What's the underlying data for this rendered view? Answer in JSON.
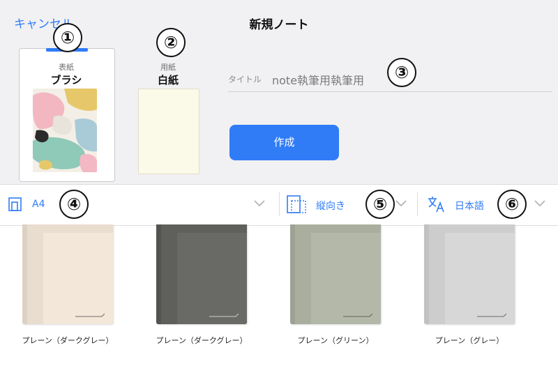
{
  "header": {
    "cancel": "キャンセル",
    "title": "新規ノート"
  },
  "cover": {
    "section_label": "表紙",
    "name": "ブラシ"
  },
  "paper": {
    "section_label": "用紙",
    "name": "白紙"
  },
  "title_field": {
    "label": "タイトル",
    "value": "note執筆用執筆用"
  },
  "create_button": "作成",
  "options": {
    "size": "A4",
    "orientation": "縦向き",
    "language": "日本語"
  },
  "annotations": [
    "①",
    "②",
    "③",
    "④",
    "⑤",
    "⑥"
  ],
  "covers": [
    {
      "label": "プレーン（ダークグレー）",
      "color": "#e9ddd0"
    },
    {
      "label": "プレーン（ダークグレー）",
      "color": "#5f5f5c"
    },
    {
      "label": "プレーン（グリーン）",
      "color": "#a9ae9e"
    },
    {
      "label": "プレーン（グレー）",
      "color": "#cdcdcd"
    }
  ],
  "colors": {
    "accent": "#2f7cf6",
    "header_bg": "#f1f1f3"
  }
}
